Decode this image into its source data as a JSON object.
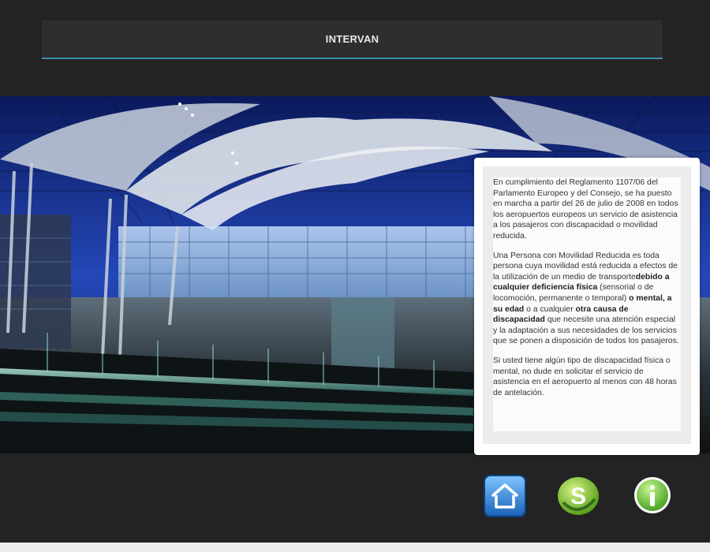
{
  "header": {
    "title": "INTERVAN"
  },
  "info": {
    "p1": "En cumplimiento del Reglamento 1107/06 del Parlamento Europeo y del Consejo, se ha puesto en marcha a partir del 26 de julio de 2008 en todos los aeropuertos europeos un servicio de asistencia a los pasajeros con discapacidad o movilidad reducida.",
    "p2_a": "Una Persona con Movilidad Reducida es toda persona cuya movilidad está reducida a efectos de la utilización de un medio de transporte",
    "p2_b": "debido a cualquier deficiencia física",
    "p2_c": " (sensorial o de locomoción, permanente o temporal) ",
    "p2_d": "o mental, a su edad",
    "p2_e": " o a cualquier ",
    "p2_f": "otra causa de discapacidad",
    "p2_g": " que necesite una atención especial y la adaptación a sus necesidades de los servicios que se ponen a disposición de todos los pasajeros.",
    "p3": "Si usted tiene algún tipo de discapacidad física o mental, no dude en solicitar el servicio de asistencia en el aeropuerto al menos con 48 horas de antelación."
  },
  "footer_icons": [
    {
      "name": "home-icon",
      "color": "#2f86d6"
    },
    {
      "name": "skype-icon",
      "color": "#7bc82a"
    },
    {
      "name": "info-icon",
      "color": "#5fbf2b"
    }
  ],
  "colors": {
    "background": "#232323",
    "header_bar": "#2e2e2e",
    "header_accent": "#3c8fa8"
  }
}
